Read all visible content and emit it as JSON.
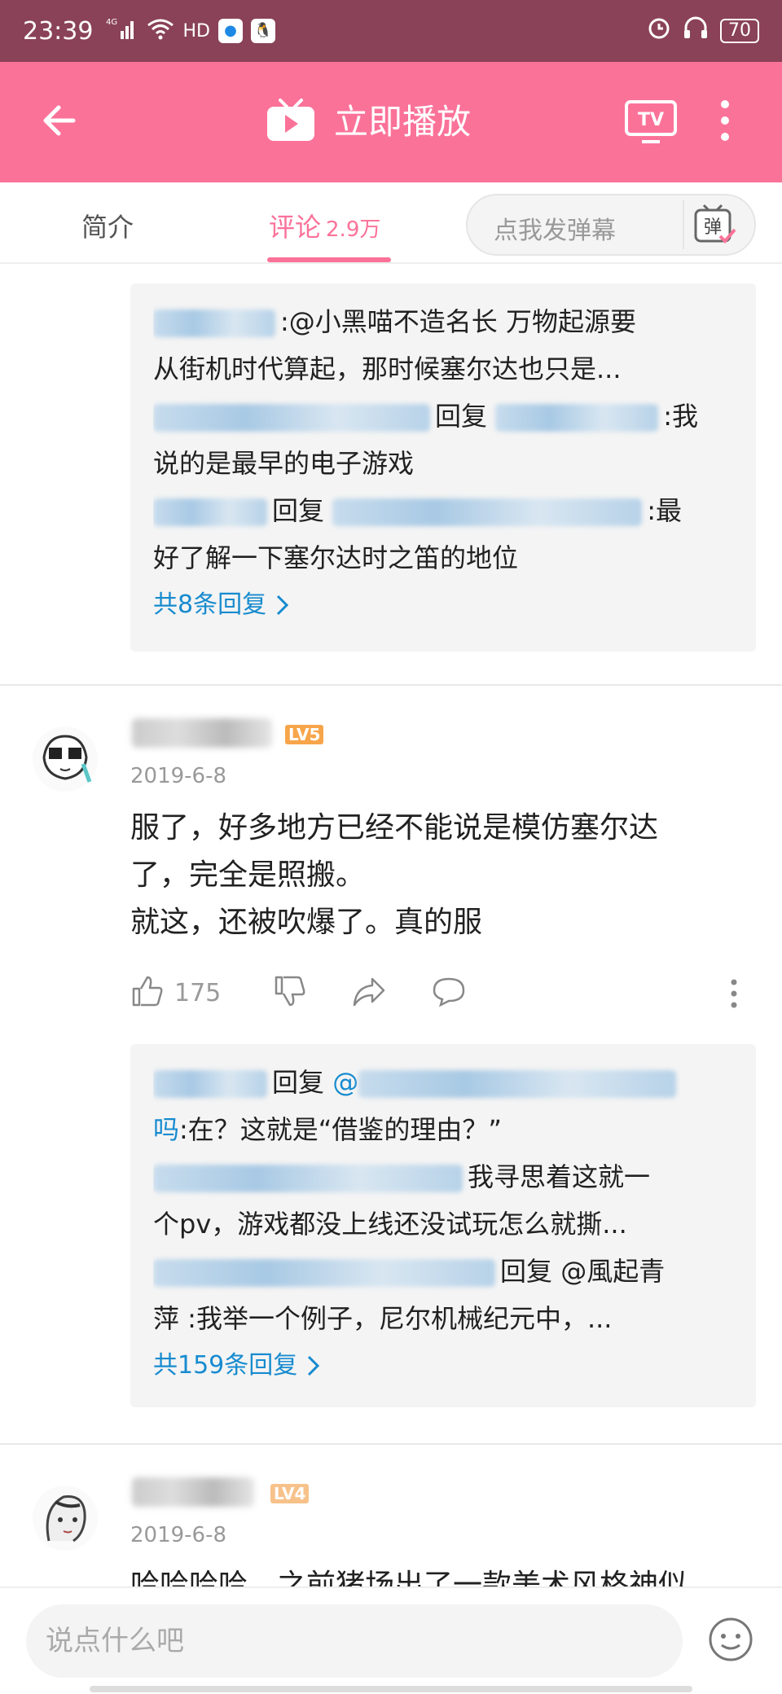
{
  "status": {
    "time": "23:39",
    "network": "4G",
    "hd": "HD",
    "battery": "70"
  },
  "appbar": {
    "title": "立即播放"
  },
  "tabs": {
    "intro": "简介",
    "comments": "评论",
    "comments_count": "2.9万",
    "danmaku_placeholder": "点我发弹幕",
    "danmaku_icon_label": "弹"
  },
  "thread1": {
    "lines": [
      ":@小黑喵不造名长 万物起源要",
      "从街机时代算起，那时候塞尔达也只是...",
      "回复",
      ":我",
      "说的是最早的电子游戏",
      "回复",
      ":最",
      "好了解一下塞尔达时之笛的地位"
    ],
    "total": "共8条回复"
  },
  "comment2": {
    "level": "LV5",
    "date": "2019-6-8",
    "text": "服了，好多地方已经不能说是模仿塞尔达\n了，完全是照搬。\n就这，还被吹爆了。真的服",
    "likes": "175",
    "replies": {
      "l1_reply": "回复",
      "l1_mention": "@",
      "l2_mention_end": "吗",
      "l2_text": ":在？这就是“借鉴的理由？”",
      "l3_text": "我寻思着这就一",
      "l4_text": "个pv，游戏都没上线还没试玩怎么就撕...",
      "l5_reply": "回复",
      "l5_text": "@風起青",
      "l6_text": "萍 :我举一个例子，尼尔机械纪元中，...",
      "total": "共159条回复"
    }
  },
  "comment3": {
    "level": "LV4",
    "date": "2019-6-8",
    "text_cut": "哈哈哈哈，之前猪场出了一款美术风格神似"
  },
  "input": {
    "placeholder": "说点什么吧"
  }
}
